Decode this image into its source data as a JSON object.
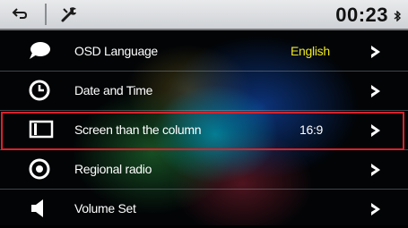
{
  "topbar": {
    "time": "00:23",
    "back_icon": "back-arrow-icon",
    "tools_icon": "wrench-screwdriver-icon",
    "bluetooth_icon": "bluetooth-icon"
  },
  "menu": [
    {
      "label": "OSD Language",
      "value": "English",
      "value_color": "#ede81e",
      "icon": "speech-bubble-icon"
    },
    {
      "label": "Date and Time",
      "value": "",
      "value_color": "#ffffff",
      "icon": "clock-icon"
    },
    {
      "label": "Screen than the column",
      "value": "16:9",
      "value_color": "#ffffff",
      "icon": "aspect-ratio-icon"
    },
    {
      "label": "Regional radio",
      "value": "",
      "value_color": "#ffffff",
      "icon": "disc-icon"
    },
    {
      "label": "Volume Set",
      "value": "",
      "value_color": "#ffffff",
      "icon": "speaker-icon"
    }
  ],
  "highlight_color": "#d8222a"
}
